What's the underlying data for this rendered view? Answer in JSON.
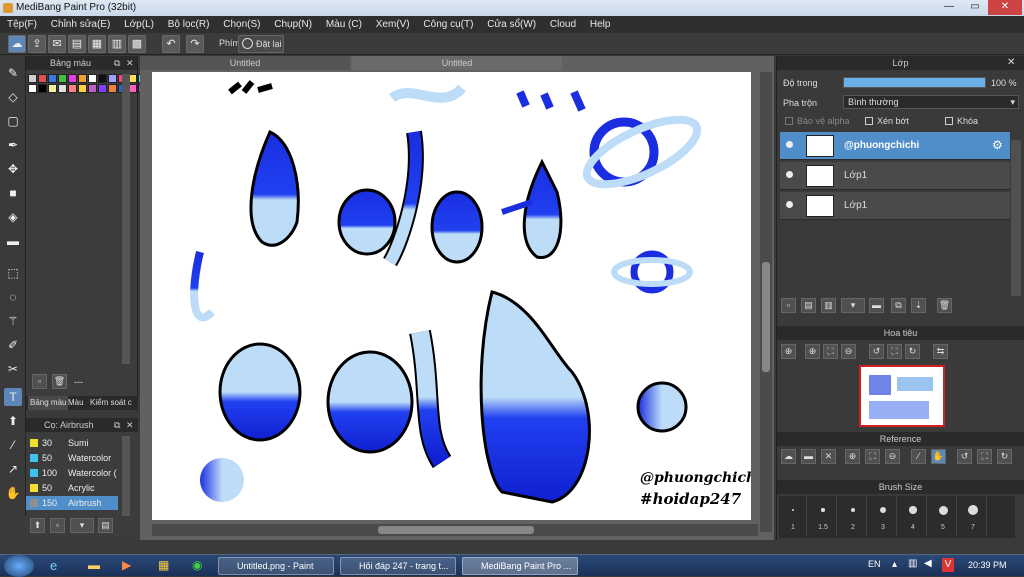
{
  "window": {
    "title": "MediBang Paint Pro (32bit)",
    "min": "—",
    "max": "▭",
    "close": "✕"
  },
  "menu": [
    "Tệp(F)",
    "Chỉnh sửa(E)",
    "Lớp(L)",
    "Bộ lọc(R)",
    "Chọn(S)",
    "Chụp(N)",
    "Màu (C)",
    "Xem(V)",
    "Công cụ(T)",
    "Cửa sổ(W)",
    "Cloud",
    "Help"
  ],
  "toolbar": {
    "phim_label": "Phím",
    "reset_label": "Đặt lại"
  },
  "tabs": [
    "Untitled",
    "Untitled"
  ],
  "palette": {
    "title": "Bảng màu",
    "colors": [
      "#d0d0d0",
      "#e05050",
      "#3a7ae0",
      "#40c040",
      "#e040e0",
      "#f0a030",
      "#ffffff",
      "#101010",
      "#a0a0ff",
      "#ff4080",
      "#ffe050",
      "#40e0e0",
      "#ffffff",
      "#000000",
      "#f0f0a0",
      "#e0e0e0",
      "#ff8080",
      "#ffd040",
      "#c060c0",
      "#8040ff",
      "#f08040",
      "#3060c0",
      "#ff60c0",
      "#a040a0"
    ],
    "count": "---"
  },
  "left_tabs": [
    "Bảng màu",
    "Màu",
    "Kiểm soát c"
  ],
  "brush_panel": {
    "title": "Cọ: Airbrush",
    "items": [
      {
        "size": "30",
        "name": "Sumi",
        "color": "#f0e030"
      },
      {
        "size": "50",
        "name": "Watercolor",
        "color": "#40c0f0"
      },
      {
        "size": "100",
        "name": "Watercolor (",
        "color": "#40c0f0"
      },
      {
        "size": "50",
        "name": "Acrylic",
        "color": "#f0e030"
      },
      {
        "size": "150",
        "name": "Airbrush",
        "color": "#909090"
      }
    ]
  },
  "layer_panel": {
    "title": "Lớp",
    "opacity_label": "Độ trong",
    "opacity_value": "100 %",
    "opacity": 1.0,
    "blend_label": "Pha trộn",
    "blend_value": "Bình thường",
    "protect_alpha": "Bảo vệ alpha",
    "clipping": "Xén bớt",
    "lock": "Khóa",
    "layers": [
      {
        "name": "@phuongchichi",
        "selected": true
      },
      {
        "name": "Lớp1",
        "selected": false
      },
      {
        "name": "Lớp1",
        "selected": false
      }
    ]
  },
  "navigator": {
    "title": "Hoa tiêu"
  },
  "reference": {
    "title": "Reference"
  },
  "brush_size": {
    "title": "Brush Size",
    "sizes": [
      "1",
      "1.5",
      "2",
      "3",
      "4",
      "5",
      "7"
    ]
  },
  "canvas": {
    "signature_1": "@phuongchichi",
    "signature_2": "#hoidap247"
  },
  "taskbar": {
    "tasks": [
      "Untitled.png - Paint",
      "Hỏi đáp 247 - trang t...",
      "MediBang Paint Pro ..."
    ],
    "lang": "EN",
    "time": "20:39 PM"
  }
}
